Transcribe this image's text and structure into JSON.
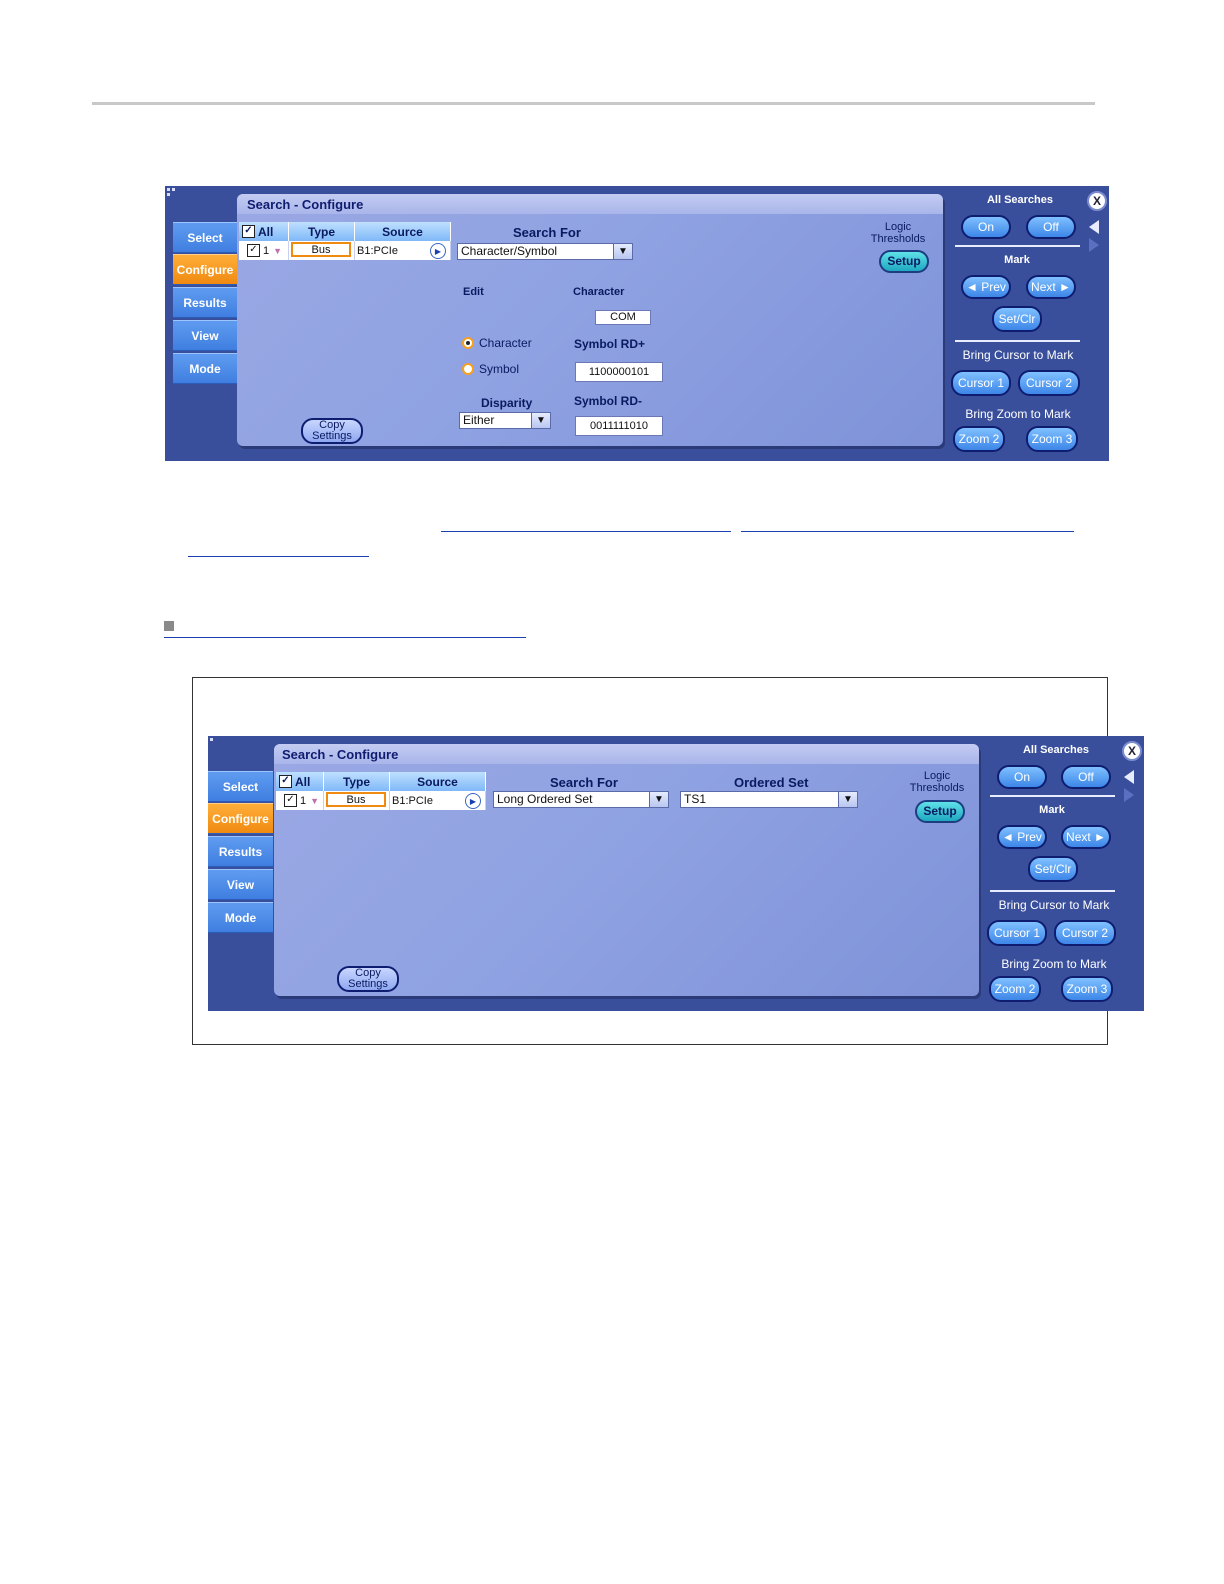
{
  "panel1": {
    "title": "Search - Configure",
    "tabs": [
      "Select",
      "Configure",
      "Results",
      "View",
      "Mode"
    ],
    "grid": {
      "all_label": "All",
      "type_header": "Type",
      "source_header": "Source",
      "row_num": "1",
      "type_value": "Bus",
      "source_value": "B1:PCIe"
    },
    "search_for_label": "Search For",
    "search_for_value": "Character/Symbol",
    "logic_label": "Logic Thresholds",
    "setup_label": "Setup",
    "edit_label": "Edit",
    "character_label": "Character",
    "character_value": "COM",
    "radio_character": "Character",
    "radio_symbol": "Symbol",
    "symbol_rdp_label": "Symbol RD+",
    "symbol_rdp_value": "1100000101",
    "disparity_label": "Disparity",
    "disparity_value": "Either",
    "symbol_rdm_label": "Symbol RD-",
    "symbol_rdm_value": "0011111010",
    "copy_label": "Copy Settings",
    "right": {
      "all_searches": "All Searches",
      "on": "On",
      "off": "Off",
      "mark": "Mark",
      "prev": "◄ Prev",
      "next": "Next ►",
      "setclr": "Set/Clr",
      "bring_cursor": "Bring Cursor to Mark",
      "cursor1": "Cursor 1",
      "cursor2": "Cursor 2",
      "bring_zoom": "Bring Zoom to Mark",
      "zoom2": "Zoom 2",
      "zoom3": "Zoom 3",
      "close": "X"
    }
  },
  "panel2": {
    "title": "Search - Configure",
    "tabs": [
      "Select",
      "Configure",
      "Results",
      "View",
      "Mode"
    ],
    "grid": {
      "all_label": "All",
      "type_header": "Type",
      "source_header": "Source",
      "row_num": "1",
      "type_value": "Bus",
      "source_value": "B1:PCIe"
    },
    "search_for_label": "Search For",
    "search_for_value": "Long Ordered Set",
    "ordered_set_label": "Ordered Set",
    "ordered_set_value": "TS1",
    "logic_label": "Logic Thresholds",
    "setup_label": "Setup",
    "copy_label": "Copy Settings",
    "right": {
      "all_searches": "All Searches",
      "on": "On",
      "off": "Off",
      "mark": "Mark",
      "prev": "◄ Prev",
      "next": "Next ►",
      "setclr": "Set/Clr",
      "bring_cursor": "Bring Cursor to Mark",
      "cursor1": "Cursor 1",
      "cursor2": "Cursor 2",
      "bring_zoom": "Bring Zoom to Mark",
      "zoom2": "Zoom 2",
      "zoom3": "Zoom 3",
      "close": "X"
    }
  },
  "colors": {
    "panel_bg": "#3a4f9c",
    "active_tab": "#f08a10",
    "tab": "#3f7ee0",
    "link": "#1a3fb0"
  }
}
